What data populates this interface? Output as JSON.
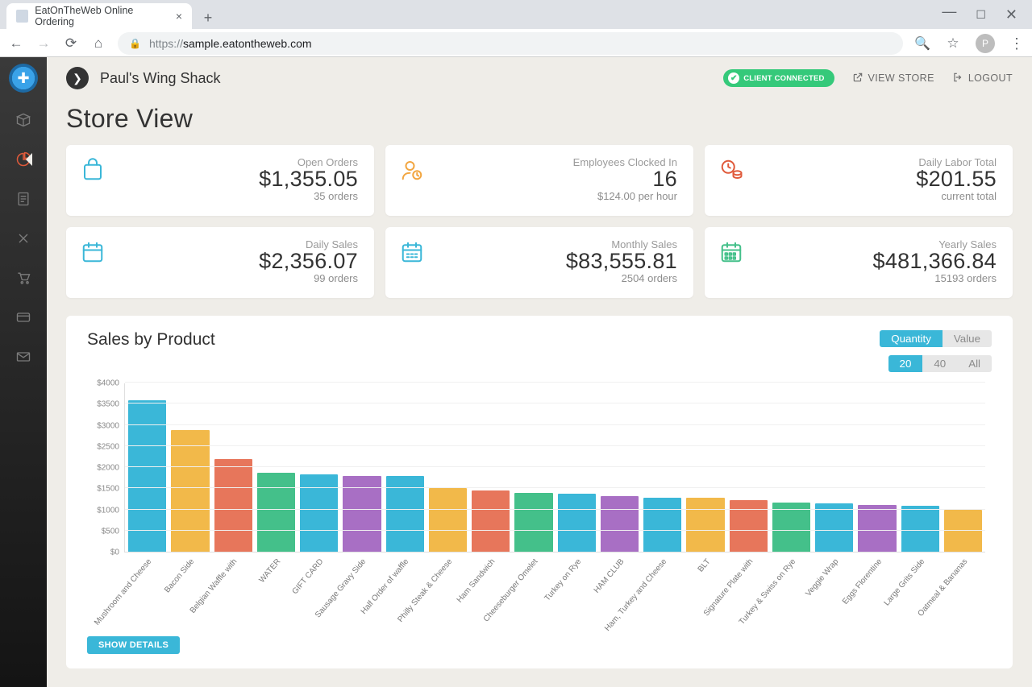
{
  "browser": {
    "tab_title": "EatOnTheWeb Online Ordering",
    "url_protocol": "https://",
    "url_rest": "sample.eatontheweb.com",
    "avatar_letter": "P"
  },
  "header": {
    "store_name": "Paul's Wing Shack",
    "connected_label": "CLIENT CONNECTED",
    "view_store": "VIEW STORE",
    "logout": "LOGOUT"
  },
  "page": {
    "title": "Store View"
  },
  "cards": [
    {
      "id": "open-orders",
      "label": "Open Orders",
      "value": "$1,355.05",
      "sub": "35 orders",
      "icon": "bag",
      "color": "#3ab7d8"
    },
    {
      "id": "employees",
      "label": "Employees Clocked In",
      "value": "16",
      "sub": "$124.00 per hour",
      "icon": "user-clock",
      "color": "#f2a641"
    },
    {
      "id": "labor",
      "label": "Daily Labor Total",
      "value": "$201.55",
      "sub": "current total",
      "icon": "coins-clock",
      "color": "#e05a3b"
    },
    {
      "id": "daily-sales",
      "label": "Daily Sales",
      "value": "$2,356.07",
      "sub": "99 orders",
      "icon": "calendar",
      "color": "#3ab7d8"
    },
    {
      "id": "monthly-sales",
      "label": "Monthly Sales",
      "value": "$83,555.81",
      "sub": "2504 orders",
      "icon": "calendar-m",
      "color": "#3ab7d8"
    },
    {
      "id": "yearly-sales",
      "label": "Yearly Sales",
      "value": "$481,366.84",
      "sub": "15193 orders",
      "icon": "calendar-y",
      "color": "#44c08a"
    }
  ],
  "chart_panel": {
    "title": "Sales by Product",
    "toggle_metric": [
      "Quantity",
      "Value"
    ],
    "toggle_metric_active": 0,
    "toggle_count": [
      "20",
      "40",
      "All"
    ],
    "toggle_count_active": 0,
    "show_details": "SHOW DETAILS"
  },
  "chart_data": {
    "type": "bar",
    "title": "Sales by Product",
    "xlabel": "",
    "ylabel": "",
    "ylim": [
      0,
      4000
    ],
    "yticks": [
      0,
      500,
      1000,
      1500,
      2000,
      2500,
      3000,
      3500,
      4000
    ],
    "ytick_labels": [
      "$0",
      "$500",
      "$1000",
      "$1500",
      "$2000",
      "$2500",
      "$3000",
      "$3500",
      "$4000"
    ],
    "palette": [
      "#3ab7d8",
      "#f2b94a",
      "#e7765b",
      "#44c08a",
      "#3ab7d8",
      "#a86fc4",
      "#3ab7d8",
      "#f2b94a",
      "#e7765b",
      "#44c08a",
      "#3ab7d8",
      "#a86fc4",
      "#3ab7d8",
      "#f2b94a",
      "#e7765b",
      "#44c08a",
      "#3ab7d8",
      "#a86fc4",
      "#3ab7d8",
      "#f2b94a"
    ],
    "categories": [
      "Mushroom and Cheese",
      "Bacon Side",
      "Belgian Waffle with",
      "WATER",
      "GIFT CARD",
      "Sausage Gravy Side",
      "Half Order of waffle",
      "Philly Steak & Cheese",
      "Ham Sandwich",
      "Cheeseburger Omelet",
      "Turkey on Rye",
      "HAM CLUB",
      "Ham, Turkey and Cheese",
      "BLT",
      "Signature Plate with",
      "Turkey & Swiss on Rye",
      "Veggie Wrap",
      "Eggs Florentine",
      "Large Grits Side",
      "Oatmeal & Bananas"
    ],
    "values": [
      3580,
      2880,
      2190,
      1860,
      1830,
      1800,
      1790,
      1500,
      1450,
      1400,
      1370,
      1310,
      1280,
      1280,
      1210,
      1160,
      1140,
      1110,
      1090,
      1000
    ]
  }
}
